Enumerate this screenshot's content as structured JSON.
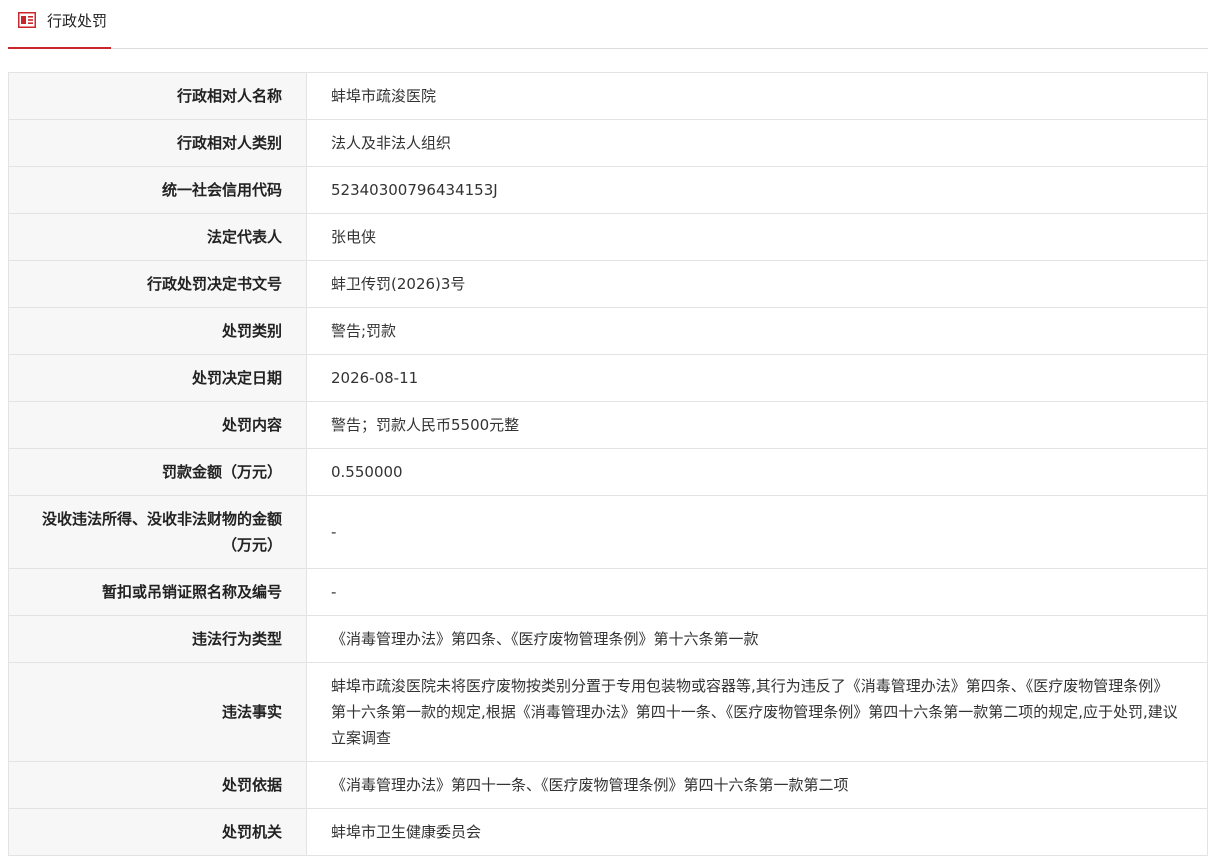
{
  "header": {
    "title": "行政处罚",
    "icon": "document-list-icon",
    "accent": "#c8282c"
  },
  "rows": [
    {
      "label": "行政相对人名称",
      "value": "蚌埠市疏浚医院"
    },
    {
      "label": "行政相对人类别",
      "value": "法人及非法人组织"
    },
    {
      "label": "统一社会信用代码",
      "value": "52340300796434153J"
    },
    {
      "label": "法定代表人",
      "value": "张电侠"
    },
    {
      "label": "行政处罚决定书文号",
      "value": "蚌卫传罚(2026)3号"
    },
    {
      "label": "处罚类别",
      "value": "警告;罚款"
    },
    {
      "label": "处罚决定日期",
      "value": "2026-08-11"
    },
    {
      "label": "处罚内容",
      "value": "警告；罚款人民币5500元整"
    },
    {
      "label": "罚款金额（万元）",
      "value": "0.550000"
    },
    {
      "label": "没收违法所得、没收非法财物的金额（万元）",
      "value": "-"
    },
    {
      "label": "暂扣或吊销证照名称及编号",
      "value": "-"
    },
    {
      "label": "违法行为类型",
      "value": "《消毒管理办法》第四条、《医疗废物管理条例》第十六条第一款"
    },
    {
      "label": "违法事实",
      "value": "蚌埠市疏浚医院未将医疗废物按类别分置于专用包装物或容器等,其行为违反了《消毒管理办法》第四条、《医疗废物管理条例》第十六条第一款的规定,根据《消毒管理办法》第四十一条、《医疗废物管理条例》第四十六条第一款第二项的规定,应于处罚,建议立案调查"
    },
    {
      "label": "处罚依据",
      "value": "《消毒管理办法》第四十一条、《医疗废物管理条例》第四十六条第一款第二项"
    },
    {
      "label": "处罚机关",
      "value": "蚌埠市卫生健康委员会"
    }
  ]
}
